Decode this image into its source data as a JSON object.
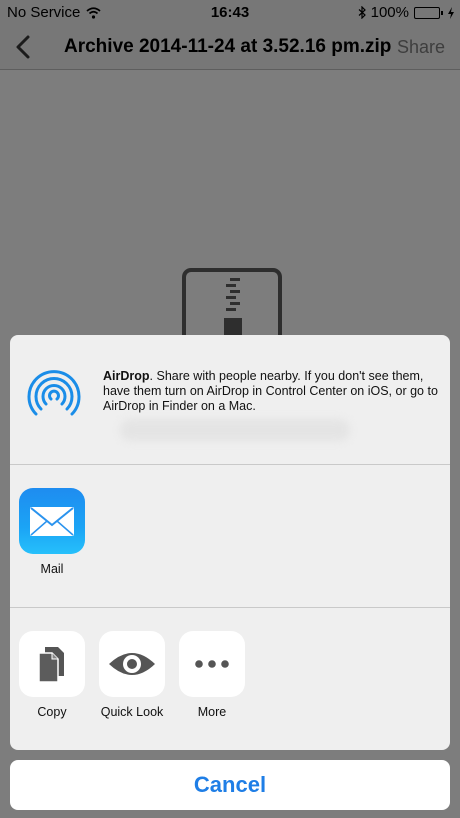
{
  "status_bar": {
    "carrier": "No Service",
    "time": "16:43",
    "battery_text": "100%",
    "icons": [
      "wifi-icon",
      "bluetooth-icon",
      "battery-icon",
      "charging-icon"
    ]
  },
  "nav": {
    "title": "Archive 2014-11-24 at 3.52.16 pm.zip",
    "share_label": "Share"
  },
  "share_sheet": {
    "airdrop": {
      "title": "AirDrop",
      "description": ". Share with people nearby. If you don't see them, have them turn on AirDrop in Control Center on iOS, or go to AirDrop in Finder on a Mac."
    },
    "apps": [
      {
        "label": "Mail",
        "icon": "mail-icon"
      }
    ],
    "actions": [
      {
        "label": "Copy",
        "icon": "copy-icon"
      },
      {
        "label": "Quick Look",
        "icon": "eye-icon"
      },
      {
        "label": "More",
        "icon": "more-icon"
      }
    ],
    "cancel_label": "Cancel"
  },
  "colors": {
    "accent": "#1f7ee6",
    "airdrop_blue": "#1a8de8",
    "battery_green": "#4cd964"
  }
}
